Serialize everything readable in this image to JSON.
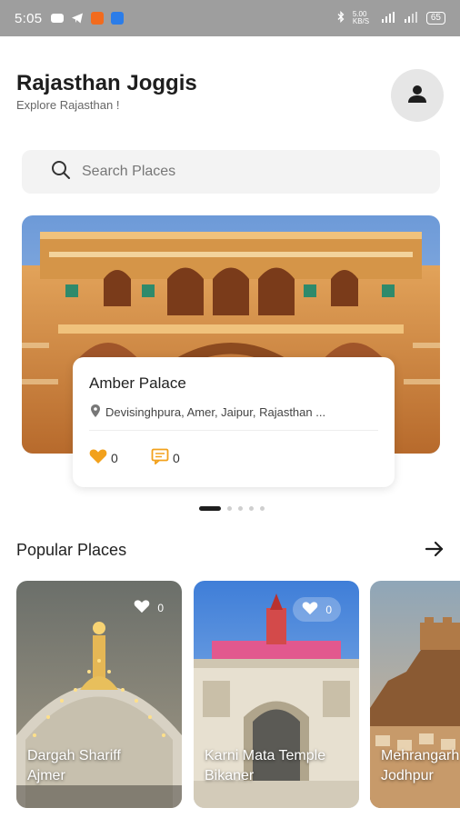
{
  "status_bar": {
    "time": "5:05",
    "network_speed": "5.00 KB/S",
    "battery": "65"
  },
  "header": {
    "title": "Rajasthan Joggis",
    "subtitle": "Explore Rajasthan !"
  },
  "search": {
    "placeholder": "Search Places",
    "value": ""
  },
  "featured": {
    "title": "Amber Palace",
    "location": "Devisinghpura, Amer, Jaipur, Rajasthan ...",
    "likes": "0",
    "comments": "0",
    "carousel_position": 1,
    "carousel_count": 5
  },
  "popular": {
    "section_title": "Popular Places",
    "items": [
      {
        "name_line1": "Dargah Shariff",
        "name_line2": "Ajmer",
        "likes": "0"
      },
      {
        "name_line1": "Karni Mata Temple",
        "name_line2": "Bikaner",
        "likes": "0"
      },
      {
        "name_line1": "Mehrangarh",
        "name_line2": "Jodhpur",
        "likes": ""
      }
    ]
  },
  "colors": {
    "accent": "#f2a11c",
    "status_bar": "#9e9e9e",
    "text_dark": "#1e1e1e"
  }
}
